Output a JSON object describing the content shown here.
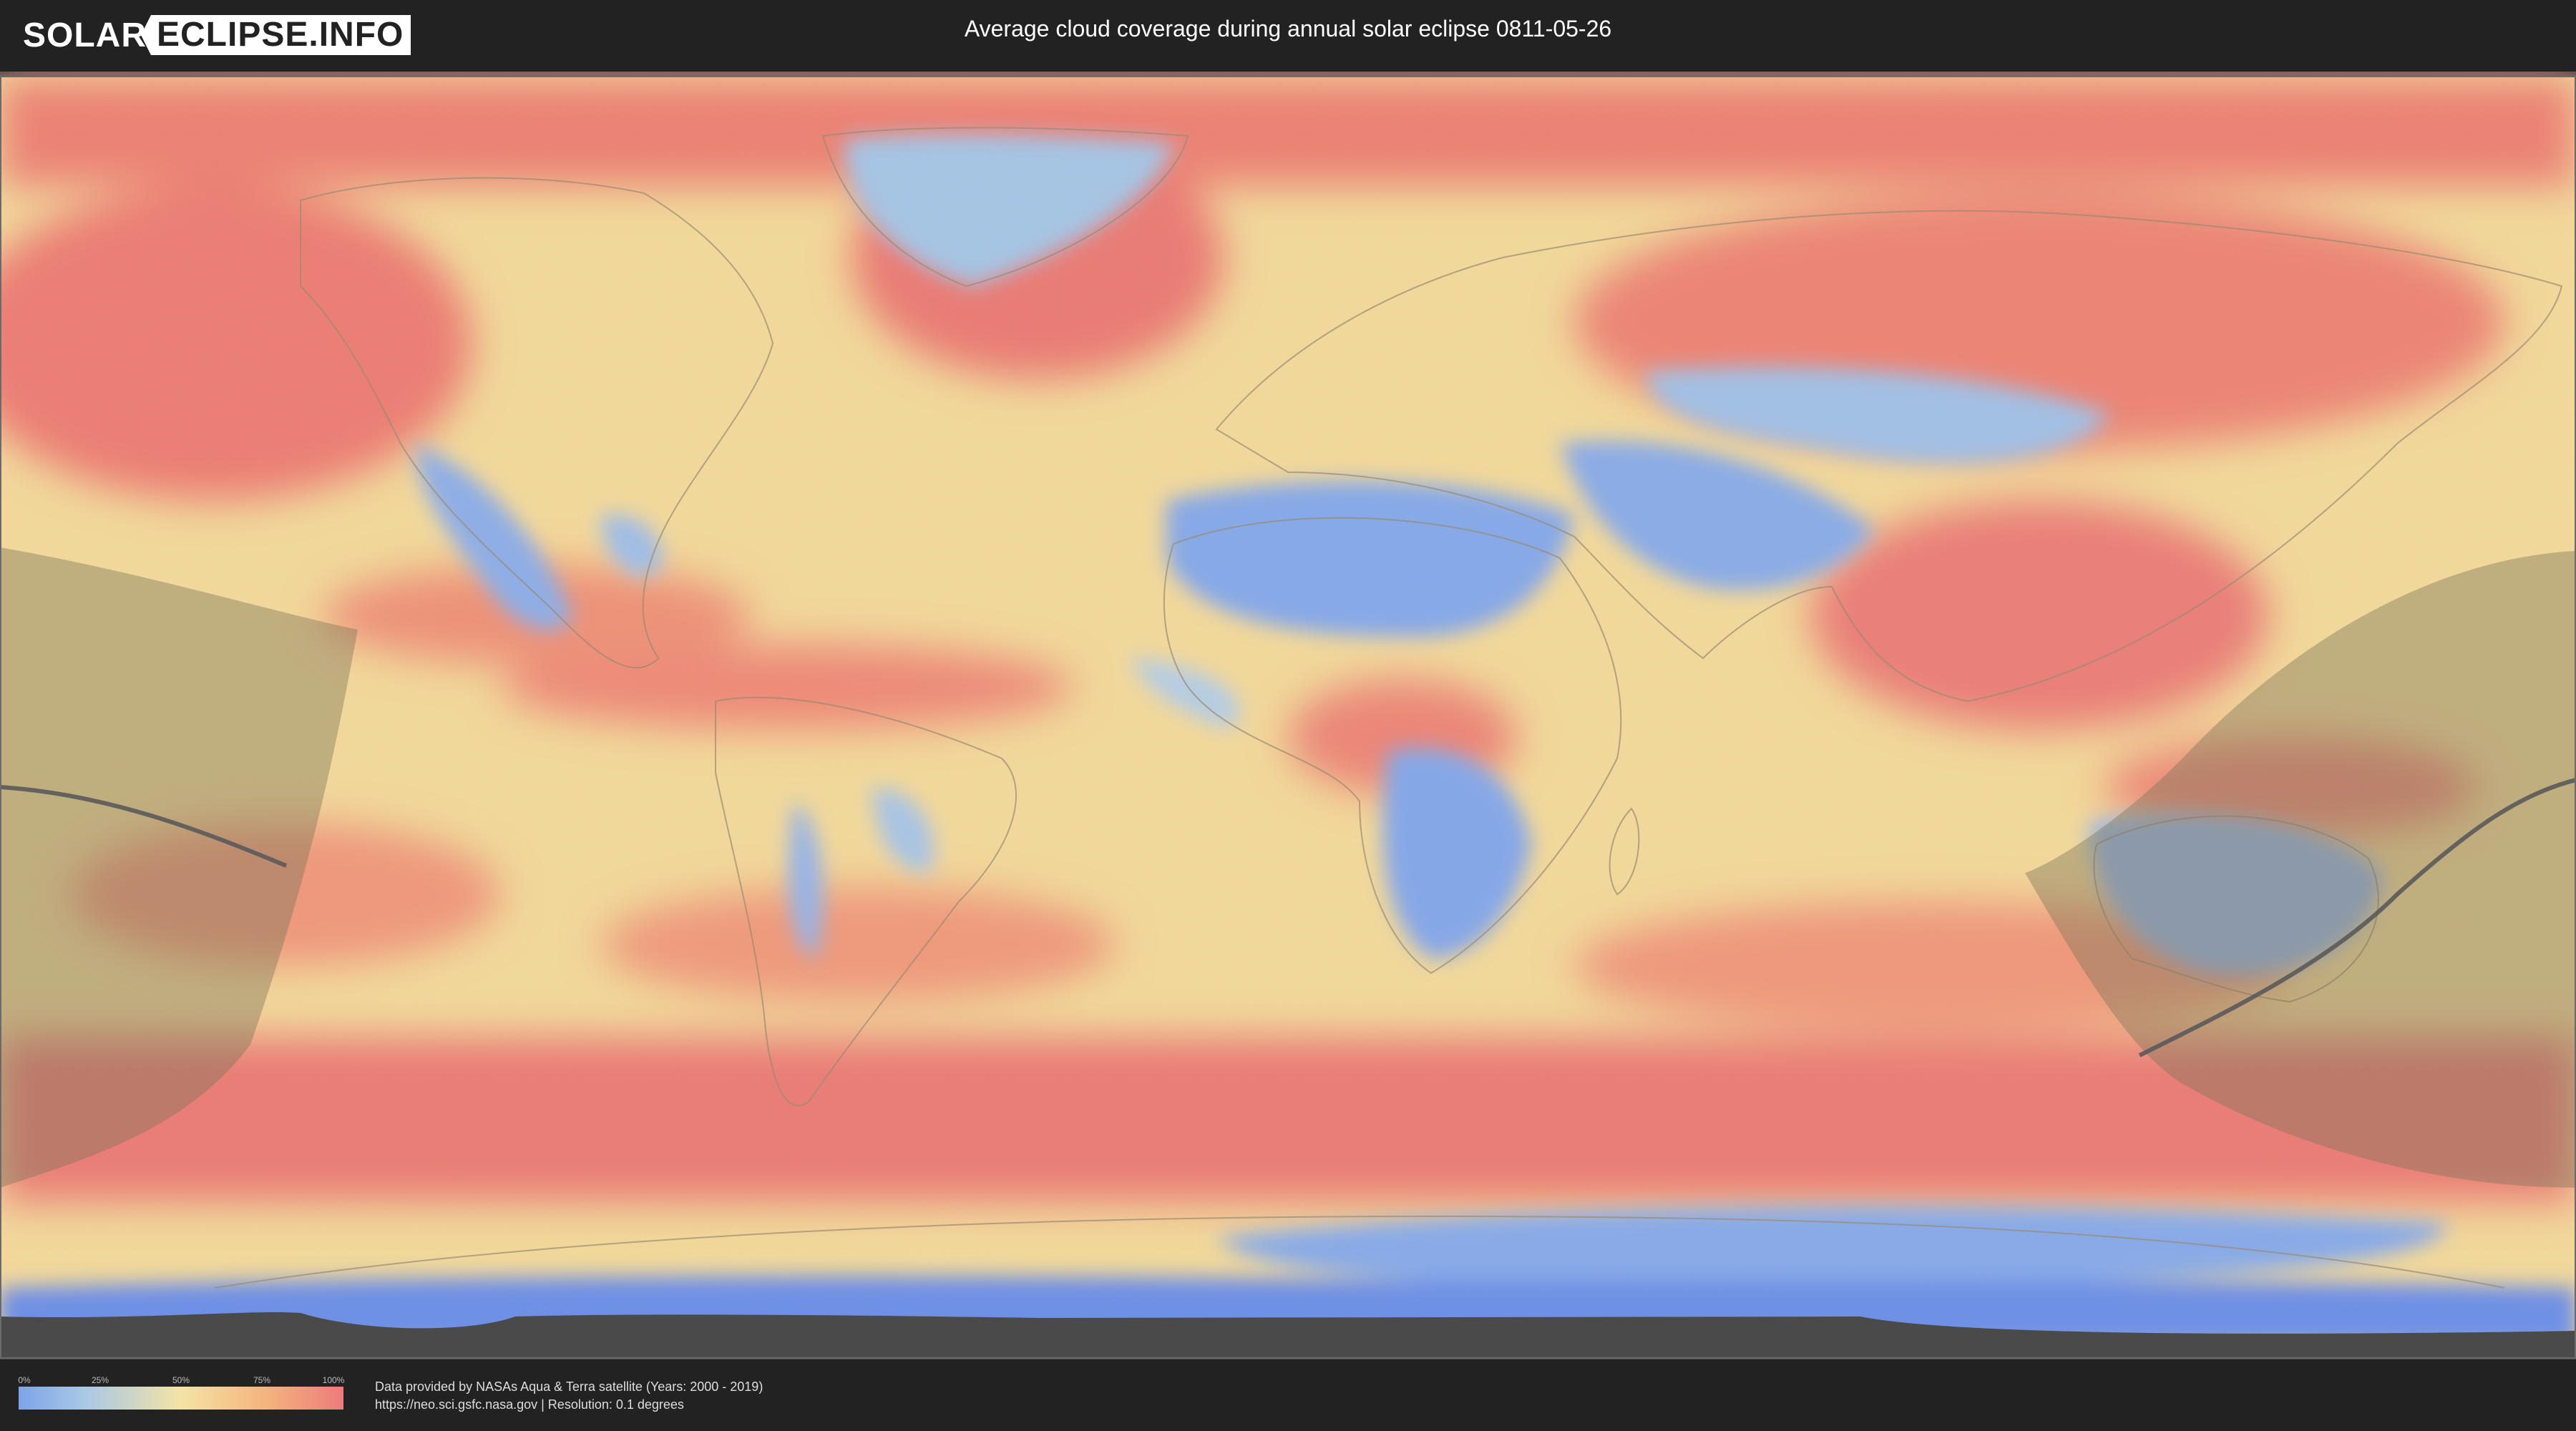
{
  "header": {
    "logo_left": "SOLAR",
    "logo_right": "ECLIPSE.INFO",
    "title": "Average cloud coverage during annual solar eclipse 0811-05-26"
  },
  "map": {
    "description_colors": {
      "low_cloud": "#7ea3e8",
      "medium_cloud": "#f3e3a6",
      "high_cloud": "#ec7b7b",
      "eclipse_overlay": "#8a8062",
      "central_line": "#555555"
    }
  },
  "legend": {
    "ticks": [
      "0%",
      "25%",
      "50%",
      "75%",
      "100%"
    ]
  },
  "credits": {
    "line1": "Data provided by NASAs Aqua & Terra satellite (Years: 2000 - 2019)",
    "line2": "https://neo.sci.gsfc.nasa.gov | Resolution: 0.1 degrees"
  }
}
